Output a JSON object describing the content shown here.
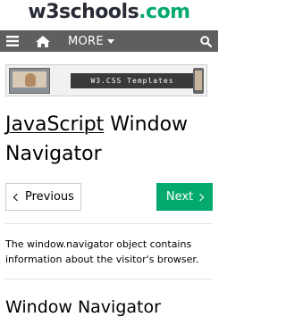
{
  "logo": {
    "part1": "w3schools",
    "part2": ".com"
  },
  "topnav": {
    "menu_icon": "hamburger-menu-icon",
    "home_icon": "home-icon",
    "more_label": "MORE",
    "search_icon": "search-icon"
  },
  "banner": {
    "label": "W3.CSS Templates"
  },
  "page": {
    "title_link": "JavaScript",
    "title_rest": " Window Navigator",
    "prev_label": "Previous",
    "next_label": "Next",
    "intro": "The window.navigator object contains information about the visitor's browser.",
    "section_heading": "Window Navigator"
  },
  "colors": {
    "accent_green": "#04aa6d",
    "nav_gray": "#5f5f5f",
    "logo_dark": "#282a35"
  }
}
